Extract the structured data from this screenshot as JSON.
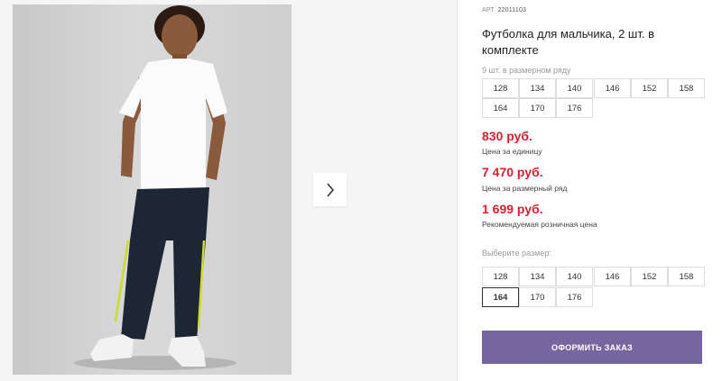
{
  "product": {
    "article_label": "АРТ.",
    "article_number": "22011103",
    "title": "Футболка для мальчика, 2 шт. в комплекте",
    "row_label": "9 шт. в размерном ряду",
    "row_sizes": [
      "128",
      "134",
      "140",
      "146",
      "152",
      "158",
      "164",
      "170",
      "176"
    ],
    "prices": [
      {
        "value": "830 руб.",
        "note": "Цена за единицу"
      },
      {
        "value": "7 470 руб.",
        "note": "Цена за размерный ряд"
      },
      {
        "value": "1 699 руб.",
        "note": "Рекомендуемая розничная цена"
      }
    ],
    "choose_label": "Выберите размер:",
    "choose_sizes": [
      "128",
      "134",
      "140",
      "146",
      "152",
      "158",
      "164",
      "170",
      "176"
    ],
    "selected_size": "164",
    "order_button": "ОФОРМИТЬ ЗАКАЗ"
  },
  "gallery": {
    "next_icon": "chevron-right-icon"
  },
  "colors": {
    "price": "#d8202f",
    "order_button": "#76659f"
  }
}
